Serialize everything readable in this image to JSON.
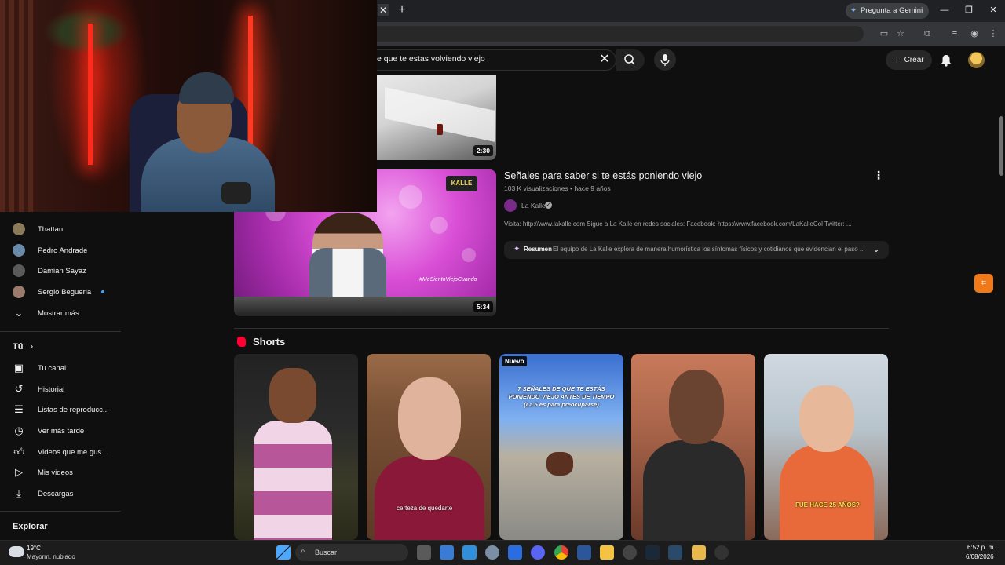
{
  "browser": {
    "gemini_label": "Pregunta a Gemini",
    "minimize": "—",
    "restore": "❐",
    "close": "✕",
    "new_tab": "+",
    "tab_close": "✕"
  },
  "youtube_header": {
    "search_value": "e que te estas volviendo viejo",
    "create_label": "Crear"
  },
  "results": [
    {
      "duration": "2:30"
    },
    {
      "title": "Señales para saber si te estás poniendo viejo",
      "meta": "103 K visualizaciones • hace 9 años",
      "channel": "La Kalle",
      "description": "Visita: http://www.lakalle.com Sigue a La Kalle en redes sociales: Facebook: https://www.facebook.com/LaKalleCol Twitter: ...",
      "summary_label": "Resumen",
      "summary_text": "El equipo de La Kalle explora de manera humorística los síntomas físicos y cotidianos que evidencian el paso ...",
      "duration": "5:34",
      "thumb_logo": "KALLE",
      "thumb_tag": "#MeSientoViejoCuando"
    }
  ],
  "shorts": {
    "title": "Shorts",
    "new_badge": "Nuevo",
    "overlay_text_3": "7 SEÑALES DE QUE TE ESTÁS PONIENDO VIEJO ANTES DE TIEMPO (La 5 es para preocuparse)",
    "caption_2": "certeza de quedarte",
    "caption_5": "FUE HACE 25 AÑOS?"
  },
  "sidebar": {
    "subscriptions": [
      {
        "name": "Thattan",
        "color": "#8a7a5a"
      },
      {
        "name": "Pedro Andrade",
        "color": "#6a8aaa"
      },
      {
        "name": "Damian Sayaz",
        "color": "#5a5a5a"
      },
      {
        "name": "Sergio Begueria",
        "color": "#9a7a6a"
      }
    ],
    "show_more": "Mostrar más",
    "you_section": "Tú",
    "you_items": [
      {
        "label": "Tu canal",
        "icon": "channel-icon"
      },
      {
        "label": "Historial",
        "icon": "history-icon"
      },
      {
        "label": "Listas de reproducc...",
        "icon": "playlist-icon"
      },
      {
        "label": "Ver más tarde",
        "icon": "clock-icon"
      },
      {
        "label": "Videos que me gus...",
        "icon": "thumbs-up-icon"
      },
      {
        "label": "Mis videos",
        "icon": "my-videos-icon"
      },
      {
        "label": "Descargas",
        "icon": "download-icon"
      }
    ],
    "explore_section": "Explorar"
  },
  "taskbar": {
    "temperature": "19°C",
    "weather": "Mayorm. nublado",
    "search_label": "Buscar",
    "time": "6:52 p. m.",
    "date": "6/08/2026"
  },
  "colors": {
    "background": "#0f0f0f",
    "accent_red": "#ff0033",
    "text_primary": "#f1f1f1",
    "text_secondary": "#aaaaaa"
  }
}
